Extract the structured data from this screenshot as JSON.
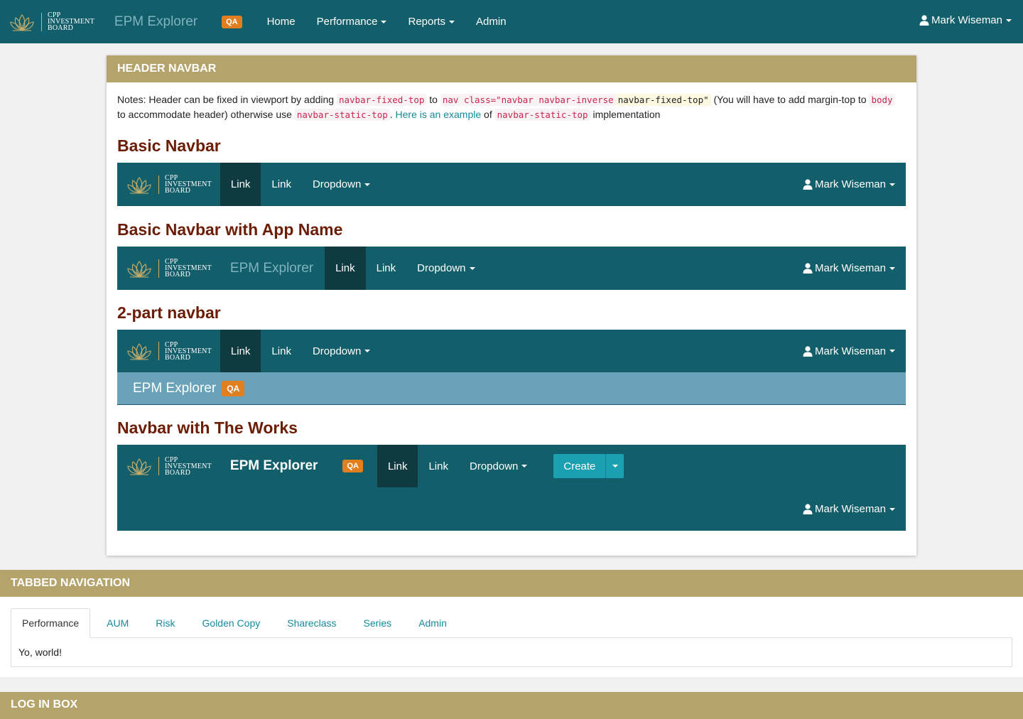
{
  "logo": {
    "line1": "CPP",
    "line2": "INVESTMENT",
    "line3": "BOARD"
  },
  "top_nav": {
    "app_name": "EPM Explorer",
    "badge": "QA",
    "links": [
      "Home",
      "Performance",
      "Reports",
      "Admin"
    ],
    "user": "Mark Wiseman"
  },
  "header_panel": {
    "title": "HEADER NAVBAR",
    "notes": {
      "t1": "Notes: Header can be fixed in viewport by adding",
      "c1": "navbar-fixed-top",
      "t2": "to",
      "c2": "nav class=\"navbar navbar-inverse",
      "c3": "navbar-fixed-top\"",
      "t3": "(You will have to add margin-top to",
      "c4": "body",
      "t4": "to accommodate header) otherwise use",
      "c5": "navbar-static-top",
      "t5": ".",
      "link": "Here is an example",
      "t6": "of",
      "c6": "navbar-static-top",
      "t7": "implementation"
    },
    "examples": {
      "basic": {
        "heading": "Basic Navbar",
        "links": [
          "Link",
          "Link",
          "Dropdown"
        ],
        "user": "Mark Wiseman"
      },
      "app_name": {
        "heading": "Basic Navbar with App Name",
        "app_name": "EPM Explorer",
        "links": [
          "Link",
          "Link",
          "Dropdown"
        ],
        "user": "Mark Wiseman"
      },
      "two_part": {
        "heading": "2-part navbar",
        "links": [
          "Link",
          "Link",
          "Dropdown"
        ],
        "user": "Mark Wiseman",
        "sub_app_name": "EPM Explorer",
        "sub_badge": "QA"
      },
      "works": {
        "heading": "Navbar with The Works",
        "app_name": "EPM Explorer",
        "badge": "QA",
        "links": [
          "Link",
          "Link",
          "Dropdown"
        ],
        "create": "Create",
        "user": "Mark Wiseman"
      }
    }
  },
  "tabbed": {
    "title": "TABBED NAVIGATION",
    "tabs": [
      "Performance",
      "AUM",
      "Risk",
      "Golden Copy",
      "Shareclass",
      "Series",
      "Admin"
    ],
    "content": "Yo, world!"
  },
  "login": {
    "title": "LOG IN BOX"
  },
  "colors": {
    "navbar": "#125e6a",
    "active_link": "#0e3a40",
    "gold": "#b4a46b",
    "badge": "#e07f1f",
    "heading": "#6b1d06",
    "link": "#168a9a"
  }
}
